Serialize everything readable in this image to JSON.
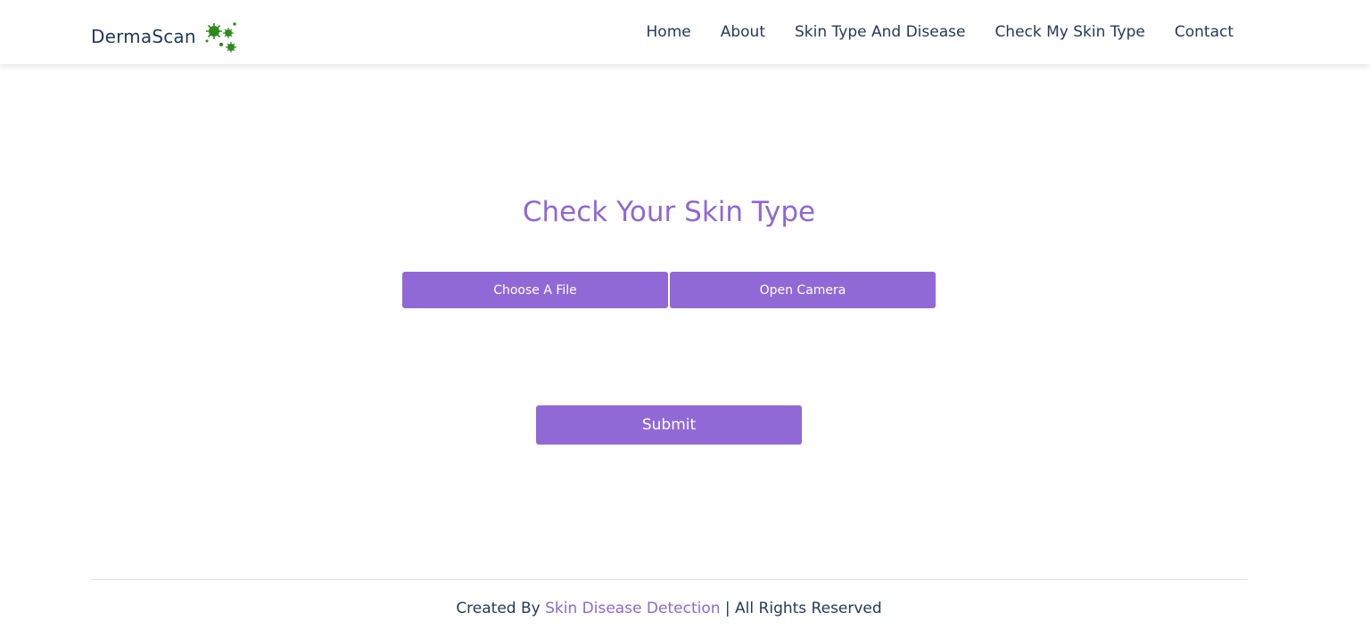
{
  "header": {
    "brand": "DermaScan",
    "logo_icon": "virus-icon",
    "nav": [
      {
        "label": "Home"
      },
      {
        "label": "About"
      },
      {
        "label": "Skin Type And Disease"
      },
      {
        "label": "Check My Skin Type"
      },
      {
        "label": "Contact"
      }
    ]
  },
  "main": {
    "title": "Check Your Skin Type",
    "choose_file_label": "Choose A File",
    "open_camera_label": "Open Camera",
    "submit_label": "Submit"
  },
  "footer": {
    "prefix": "Created By ",
    "link_text": "Skin Disease Detection",
    "suffix": " | All Rights Reserved"
  },
  "colors": {
    "accent": "#9169d6",
    "text": "#1f3a5a",
    "logo_green": "#2e8b1e"
  }
}
